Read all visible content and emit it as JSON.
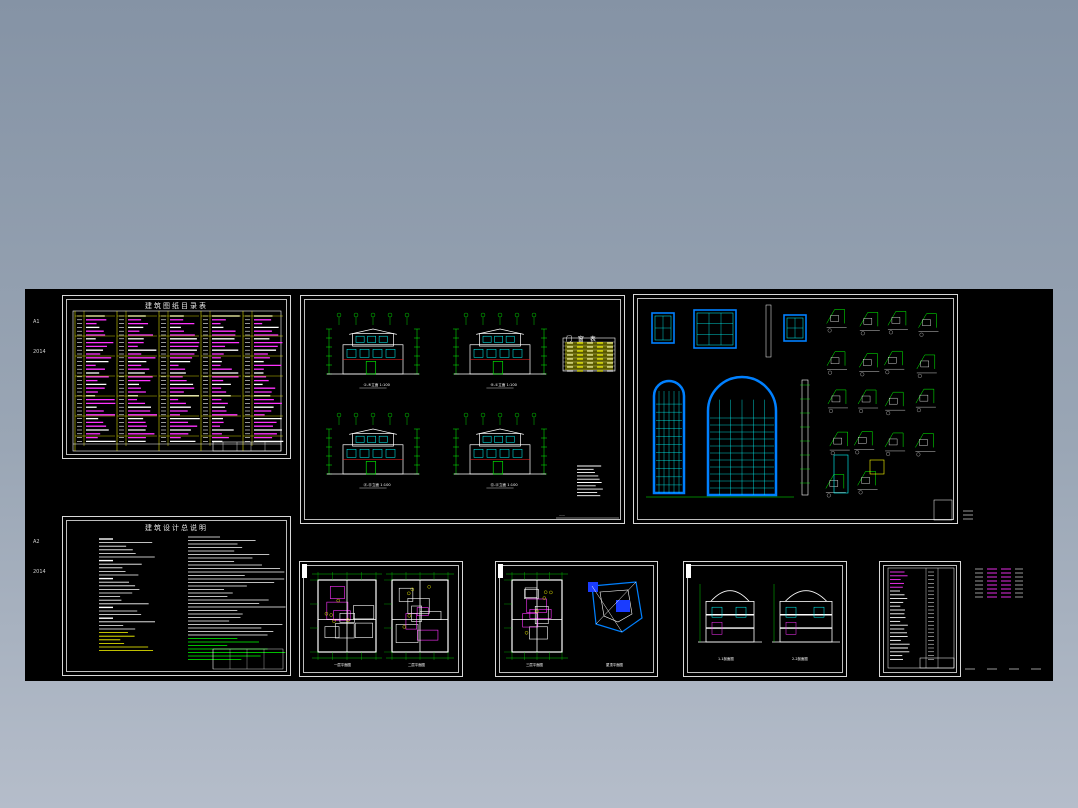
{
  "canvas": {
    "background_color": "#000000",
    "margin_marks": [
      "A1",
      "2014",
      "A2",
      "2014"
    ]
  },
  "sheets": [
    {
      "id": "sheet-drawing-list",
      "title": "建筑图纸目录表",
      "kind": "table",
      "accent": "#ff33ff"
    },
    {
      "id": "sheet-elevations",
      "title": "",
      "kind": "elevations",
      "labels": [
        "①-⑤立面 1:100",
        "⑤-①立面 1:100",
        "Ⓐ-Ⓓ立面 1:100",
        "Ⓓ-Ⓐ立面 1:100"
      ],
      "door_window_table_title": "门 窗 表"
    },
    {
      "id": "sheet-details",
      "title": "",
      "kind": "details",
      "accent": "#00a0ff"
    },
    {
      "id": "sheet-design-notes",
      "title": "建筑设计总说明",
      "kind": "notes"
    },
    {
      "id": "sheet-floor-plans-1",
      "title": "",
      "kind": "plans",
      "labels": [
        "一层平面图",
        "二层平面图"
      ]
    },
    {
      "id": "sheet-floor-plans-2",
      "title": "",
      "kind": "plans",
      "labels": [
        "三层平面图",
        "屋顶平面图"
      ]
    },
    {
      "id": "sheet-sections",
      "title": "",
      "kind": "sections",
      "labels": [
        "1-1剖面图",
        "2-2剖面图"
      ]
    },
    {
      "id": "sheet-index",
      "title": "",
      "kind": "index"
    }
  ],
  "colors": {
    "line_green": "#00ff00",
    "line_cyan": "#00ffff",
    "line_yellow": "#ffff00",
    "line_magenta": "#ff33ff",
    "line_white": "#ffffff",
    "line_blue": "#0080ff",
    "line_red": "#ff2020"
  }
}
